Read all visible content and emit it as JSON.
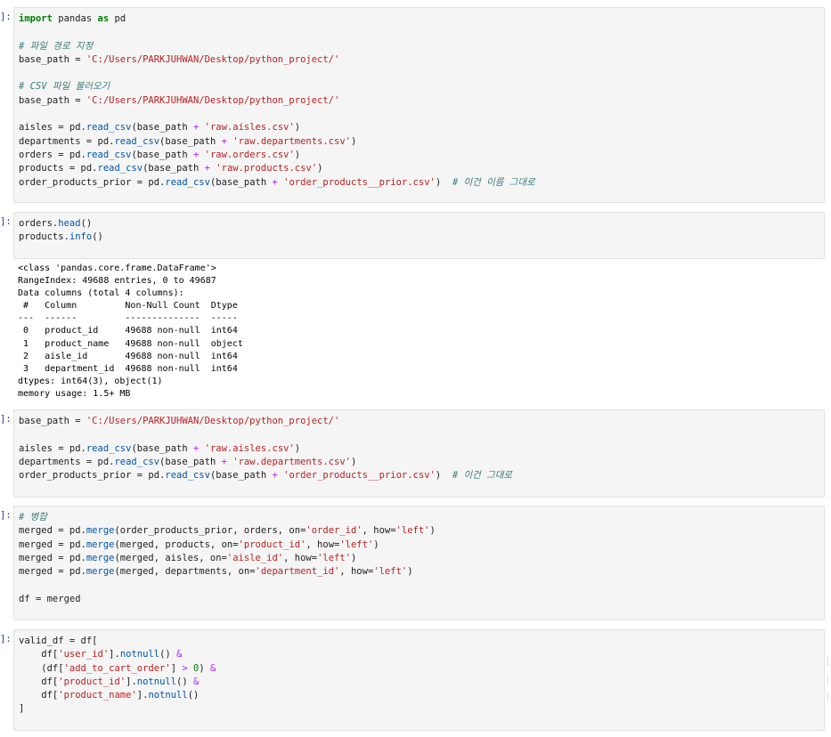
{
  "prompts": [
    "]:",
    "]:",
    "]:",
    "]:",
    "]:"
  ],
  "cell1": {
    "import_kw": "import",
    "pandas": " pandas ",
    "as_kw": "as",
    "pd_name": " pd",
    "comment_path": "# 파일 경로 지정",
    "base_path_lhs": "base_path = ",
    "base_path_val": "'C:/Users/PARKJUHWAN/Desktop/python_project/'",
    "comment_csv": "# CSV 파일 불러오기",
    "aisles_lhs": "aisles = pd.",
    "aisles_str": "'raw.aisles.csv'",
    "departments_lhs": "departments = pd.",
    "departments_str": "'raw.departments.csv'",
    "orders_lhs": "orders = pd.",
    "orders_str": "'raw.orders.csv'",
    "products_lhs": "products = pd.",
    "products_str": "'raw.products.csv'",
    "prior_lhs": "order_products_prior = pd.",
    "prior_str": "'order_products__prior.csv'",
    "comment_name": "# 이건 이름 그대로",
    "read_csv": "read_csv",
    "base_arg": "(base_path ",
    "plus": "+"
  },
  "cell2": {
    "orders_obj": "orders.",
    "head_fn": "head",
    "products_obj": "products.",
    "info_fn": "info"
  },
  "output2": {
    "text": "<class 'pandas.core.frame.DataFrame'>\nRangeIndex: 49688 entries, 0 to 49687\nData columns (total 4 columns):\n #   Column         Non-Null Count  Dtype \n---  ------         --------------  ----- \n 0   product_id     49688 non-null  int64 \n 1   product_name   49688 non-null  object\n 2   aisle_id       49688 non-null  int64 \n 3   department_id  49688 non-null  int64 \ndtypes: int64(3), object(1)\nmemory usage: 1.5+ MB"
  },
  "cell3": {
    "base_path_lhs": "base_path = ",
    "base_path_val": "'C:/Users/PARKJUHWAN/Desktop/python_project/'",
    "aisles_lhs": "aisles = pd.",
    "aisles_str": "'raw.aisles.csv'",
    "departments_lhs": "departments = pd.",
    "departments_str": "'raw.departments.csv'",
    "prior_lhs": "order_products_prior = pd.",
    "prior_str": "'order_products__prior.csv'",
    "comment_name": "# 이건 그대로"
  },
  "cell4": {
    "comment_merge": "# 병합",
    "m1_lhs": "merged = pd.",
    "m1_args": "(order_products_prior, orders, on=",
    "m1_key": "'order_id'",
    "m2_lhs": "merged = pd.",
    "m2_args": "(merged, products, on=",
    "m2_key": "'product_id'",
    "m3_lhs": "merged = pd.",
    "m3_args": "(merged, aisles, on=",
    "m3_key": "'aisle_id'",
    "m4_lhs": "merged = pd.",
    "m4_args": "(merged, departments, on=",
    "m4_key": "'department_id'",
    "merge_fn": "merge",
    "how": ", how=",
    "left": "'left'",
    "df_line": "df = merged"
  },
  "cell5": {
    "open": "valid_df = df[",
    "user_id": "'user_id'",
    "add_to_cart": "'add_to_cart_order'",
    "product_id": "'product_id'",
    "product_name": "'product_name'",
    "notnull": "notnull",
    "gt_zero": "0",
    "close": "]"
  }
}
